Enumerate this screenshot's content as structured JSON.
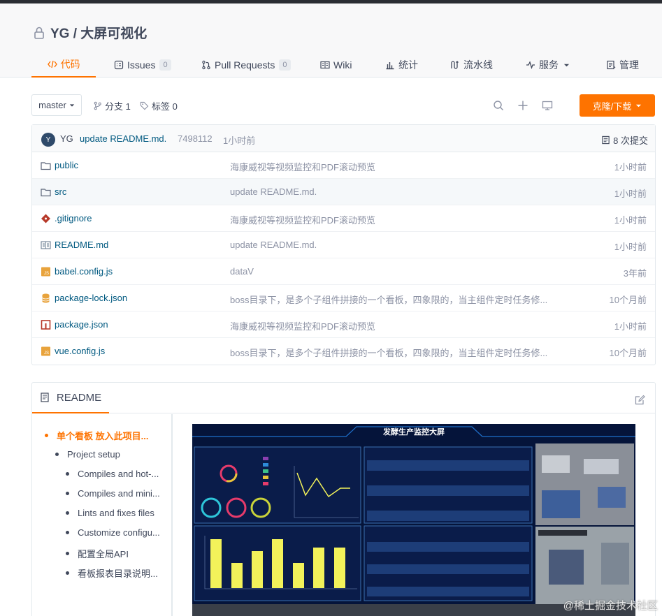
{
  "repo": {
    "title": "YG / 大屏可视化"
  },
  "tabs": [
    {
      "label": "代码"
    },
    {
      "label": "Issues",
      "count": "0"
    },
    {
      "label": "Pull Requests",
      "count": "0"
    },
    {
      "label": "Wiki"
    },
    {
      "label": "统计"
    },
    {
      "label": "流水线"
    },
    {
      "label": "服务"
    },
    {
      "label": "管理"
    }
  ],
  "toolbar": {
    "branch": "master",
    "branches_label": "分支 1",
    "tags_label": "标签 0",
    "clone_label": "克隆/下载"
  },
  "commit": {
    "avatar_letter": "Y",
    "author": "YG",
    "message": "update README.md.",
    "hash": "7498112",
    "time": "1小时前",
    "count_label": "8 次提交"
  },
  "files": [
    {
      "name": "public",
      "icon": "folder-icon",
      "message": "海康威视等视频监控和PDF滚动预览",
      "time": "1小时前"
    },
    {
      "name": "src",
      "icon": "folder-icon",
      "message": "update README.md.",
      "time": "1小时前"
    },
    {
      "name": ".gitignore",
      "icon": "git-icon",
      "message": "海康威视等视频监控和PDF滚动预览",
      "time": "1小时前"
    },
    {
      "name": "README.md",
      "icon": "readme-icon",
      "message": "update README.md.",
      "time": "1小时前"
    },
    {
      "name": "babel.config.js",
      "icon": "js-icon",
      "message": "dataV",
      "time": "3年前"
    },
    {
      "name": "package-lock.json",
      "icon": "database-icon",
      "message": "boss目录下，是多个子组件拼接的一个看板，四象限的，当主组件定时任务修...",
      "time": "10个月前"
    },
    {
      "name": "package.json",
      "icon": "npm-icon",
      "message": "海康威视等视频监控和PDF滚动预览",
      "time": "1小时前"
    },
    {
      "name": "vue.config.js",
      "icon": "js-icon",
      "message": "boss目录下，是多个子组件拼接的一个看板，四象限的，当主组件定时任务修...",
      "time": "10个月前"
    }
  ],
  "readme": {
    "tab_label": "README",
    "toc": [
      {
        "label": "单个看板 放入此项目...",
        "level": 1
      },
      {
        "label": "Project setup",
        "level": 2
      },
      {
        "label": "Compiles and hot-...",
        "level": 3
      },
      {
        "label": "Compiles and mini...",
        "level": 3
      },
      {
        "label": "Lints and fixes files",
        "level": 3
      },
      {
        "label": "Customize configu...",
        "level": 3
      },
      {
        "label": "配置全局API",
        "level": 3
      },
      {
        "label": "看板报表目录说明...",
        "level": 3
      }
    ],
    "preview_title": "发酵生产监控大屏"
  },
  "watermark": "@稀土掘金技术社区",
  "colors": {
    "accent": "#fe7300",
    "link": "#005980",
    "muted": "#8c92a4"
  }
}
